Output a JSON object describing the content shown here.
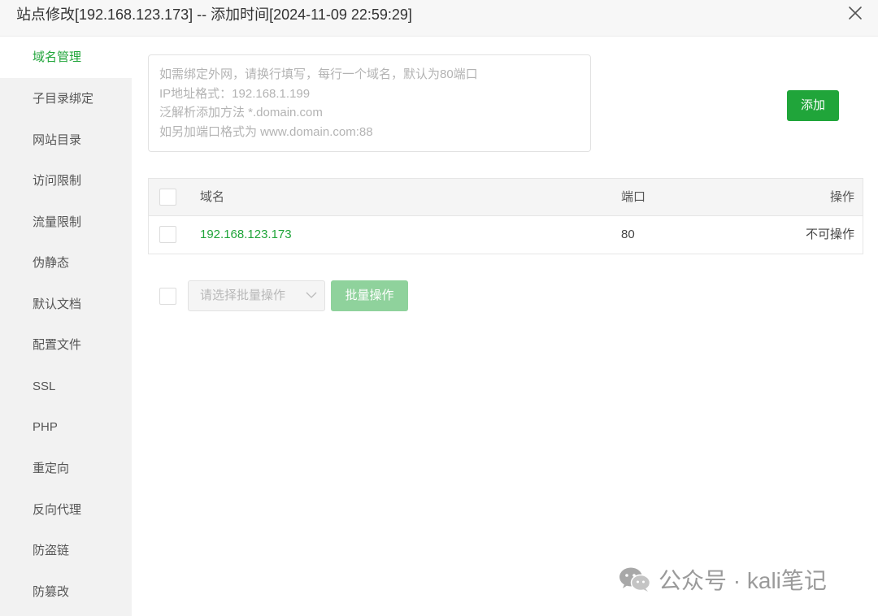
{
  "dialog": {
    "title": "站点修改[192.168.123.173] -- 添加时间[2024-11-09 22:59:29]",
    "close_icon": "close-icon"
  },
  "sidebar": {
    "items": [
      {
        "label": "域名管理",
        "active": true
      },
      {
        "label": "子目录绑定",
        "active": false
      },
      {
        "label": "网站目录",
        "active": false
      },
      {
        "label": "访问限制",
        "active": false
      },
      {
        "label": "流量限制",
        "active": false
      },
      {
        "label": "伪静态",
        "active": false
      },
      {
        "label": "默认文档",
        "active": false
      },
      {
        "label": "配置文件",
        "active": false
      },
      {
        "label": "SSL",
        "active": false
      },
      {
        "label": "PHP",
        "active": false
      },
      {
        "label": "重定向",
        "active": false
      },
      {
        "label": "反向代理",
        "active": false
      },
      {
        "label": "防盗链",
        "active": false
      },
      {
        "label": "防篡改",
        "active": false
      }
    ]
  },
  "domain_input": {
    "placeholder_lines": [
      "如需绑定外网，请换行填写，每行一个域名，默认为80端口",
      "IP地址格式：192.168.1.199",
      "泛解析添加方法 *.domain.com",
      "如另加端口格式为 www.domain.com:88"
    ],
    "value": ""
  },
  "add_button": {
    "label": "添加"
  },
  "table": {
    "headers": {
      "domain": "域名",
      "port": "端口",
      "action": "操作"
    },
    "rows": [
      {
        "domain": "192.168.123.173",
        "port": "80",
        "action": "不可操作"
      }
    ]
  },
  "batch": {
    "select_placeholder": "请选择批量操作",
    "button_label": "批量操作"
  },
  "watermark": {
    "text": "公众号 · kali笔记",
    "icon": "wechat-icon"
  },
  "colors": {
    "accent": "#20a53a",
    "accent_disabled": "#8fd29c",
    "sidebar_bg": "#f2f2f2"
  }
}
